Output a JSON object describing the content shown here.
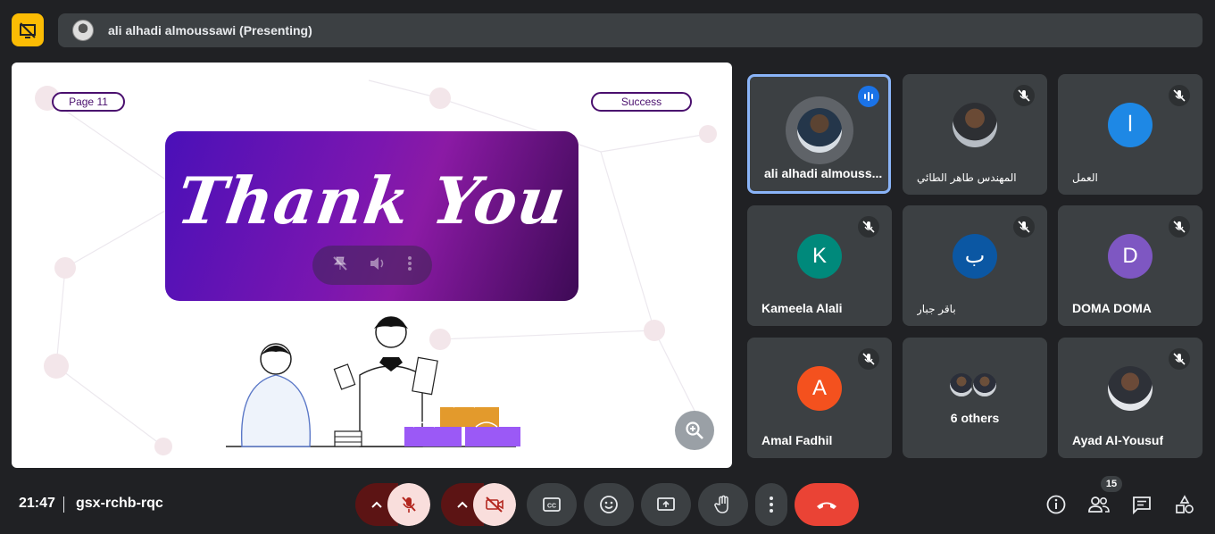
{
  "presenter_bar": {
    "label": "ali alhadi almoussawi (Presenting)"
  },
  "slide": {
    "page_label": "Page 11",
    "success_label": "Success",
    "headline": "Thank You"
  },
  "participants": [
    {
      "name": "ali alhadi almouss...",
      "avatar_type": "photo",
      "speaking": true
    },
    {
      "name": "المهندس طاهر الطائي",
      "avatar_type": "photo",
      "muted": true
    },
    {
      "name": "العمل",
      "initial": "ا",
      "avatar_color": "#1e88e5",
      "muted": true
    },
    {
      "name": "Kameela Alali",
      "initial": "K",
      "avatar_color": "#00897b",
      "muted": true
    },
    {
      "name": "باقر جبار",
      "initial": "ب",
      "avatar_color": "#0b57a3",
      "muted": true
    },
    {
      "name": "DOMA DOMA",
      "initial": "D",
      "avatar_color": "#7e57c2",
      "muted": true
    },
    {
      "name": "Amal Fadhil",
      "initial": "A",
      "avatar_color": "#f4511e",
      "muted": true
    },
    {
      "name": "6 others",
      "avatar_type": "group"
    },
    {
      "name": "Ayad Al-Yousuf",
      "avatar_type": "photo",
      "muted": true
    }
  ],
  "footer": {
    "time": "21:47",
    "meeting_code": "gsx-rchb-rqc",
    "participant_count": "15"
  },
  "colors": {
    "accent_blue": "#8ab4f8",
    "end_call_red": "#ea4335",
    "muted_bg": "#f9dedc",
    "presenting_yellow": "#fbbc04"
  }
}
